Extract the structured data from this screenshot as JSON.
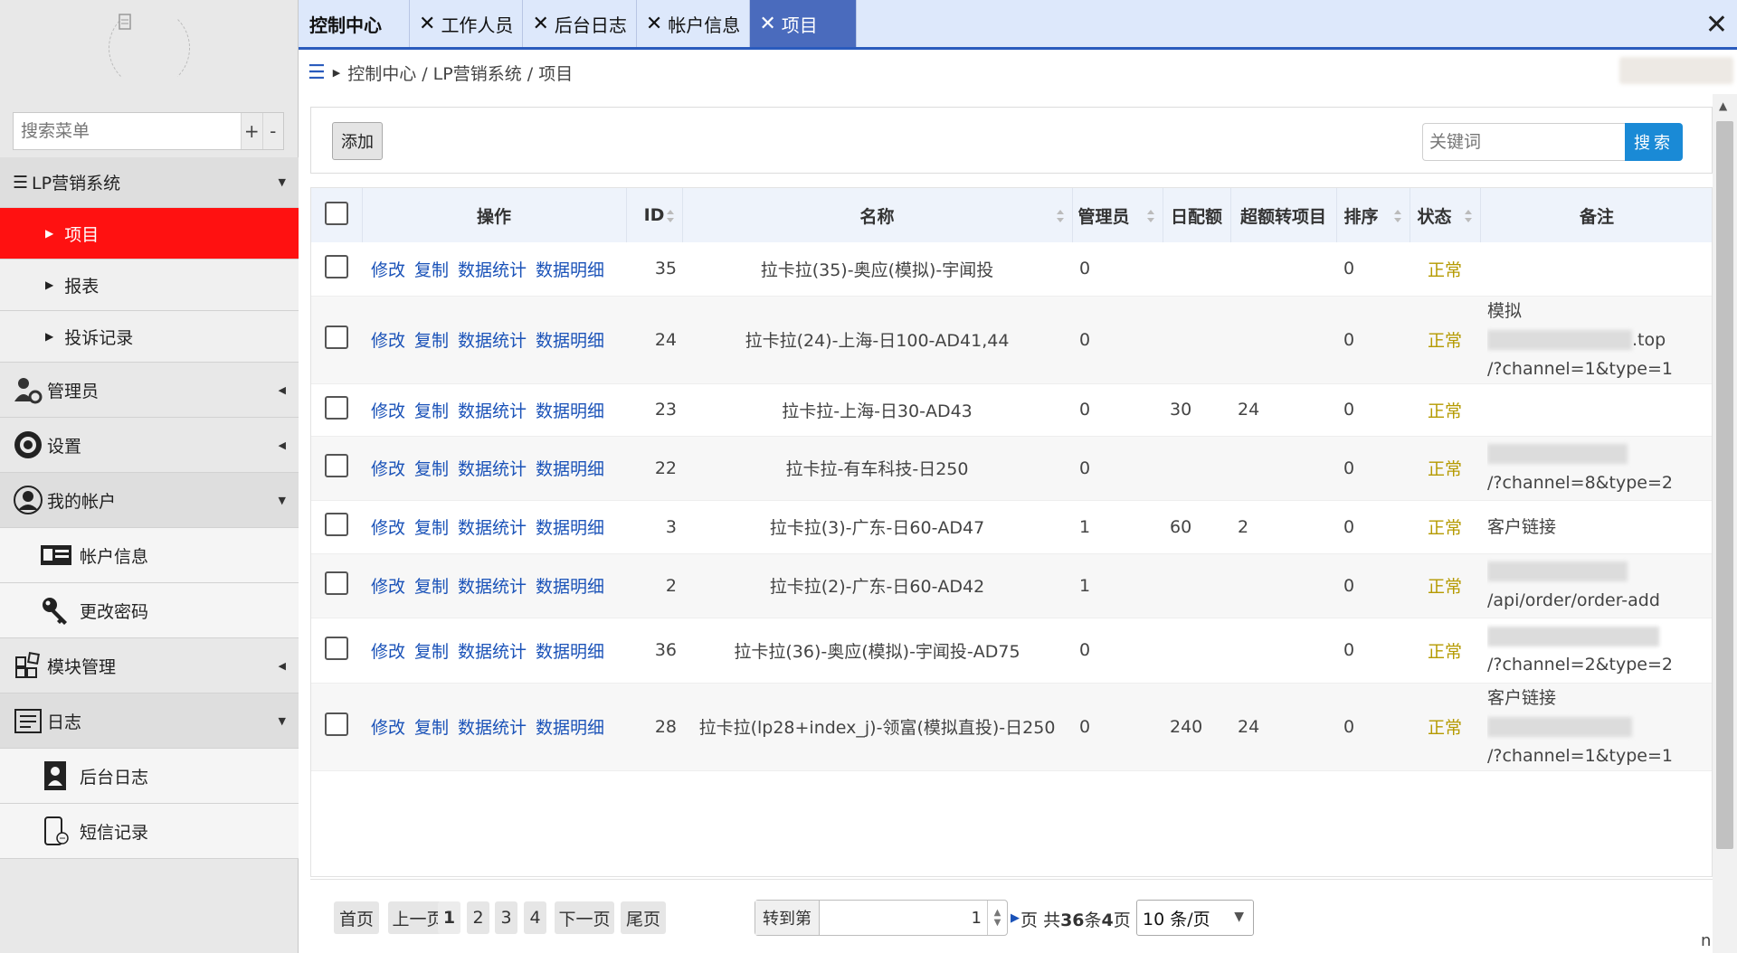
{
  "sidebar": {
    "search_placeholder": "搜索菜单",
    "expand_label": "+",
    "collapse_label": "-",
    "items": {
      "lp": "LP营销系统",
      "project": "项目",
      "report": "报表",
      "complaint": "投诉记录",
      "admin": "管理员",
      "settings": "设置",
      "myaccount": "我的帐户",
      "account_info": "帐户信息",
      "change_pwd": "更改密码",
      "modules": "模块管理",
      "log": "日志",
      "backend_log": "后台日志",
      "sms_log": "短信记录"
    }
  },
  "tabs": {
    "home": "控制中心",
    "staff": "工作人员",
    "backlog": "后台日志",
    "account": "帐户信息",
    "project": "项目",
    "close_all": "✕"
  },
  "breadcrumb": {
    "text": "控制中心 / LP营销系统 / 项目"
  },
  "toolbar": {
    "add_label": "添加",
    "keyword_placeholder": "关键词",
    "search_label": "搜索"
  },
  "table": {
    "headers": {
      "op": "操作",
      "id": "ID",
      "name": "名称",
      "admin": "管理员",
      "daily": "日配额",
      "over": "超额转项目",
      "sort": "排序",
      "status": "状态",
      "note": "备注"
    },
    "ops": {
      "edit": "修改",
      "copy": "复制",
      "stats": "数据统计",
      "detail": "数据明细"
    },
    "rows": [
      {
        "id": "35",
        "name": "拉卡拉(35)-奥应(模拟)-宇闻投",
        "admin": "0",
        "daily": "",
        "over": "",
        "sort": "0",
        "status": "正常",
        "note1": "",
        "note2": "",
        "note3": ""
      },
      {
        "id": "24",
        "name": "拉卡拉(24)-上海-日100-AD41,44",
        "admin": "0",
        "daily": "",
        "over": "",
        "sort": "0",
        "status": "正常",
        "note1": "模拟",
        "note2": ".top",
        "note3": "/?channel=1&type=1"
      },
      {
        "id": "23",
        "name": "拉卡拉-上海-日30-AD43",
        "admin": "0",
        "daily": "30",
        "over": "24",
        "sort": "0",
        "status": "正常",
        "note1": "",
        "note2": "",
        "note3": ""
      },
      {
        "id": "22",
        "name": "拉卡拉-有车科技-日250",
        "admin": "0",
        "daily": "",
        "over": "",
        "sort": "0",
        "status": "正常",
        "note1": "",
        "note2": "/?channel=8&type=2",
        "note3": ""
      },
      {
        "id": "3",
        "name": "拉卡拉(3)-广东-日60-AD47",
        "admin": "1",
        "daily": "60",
        "over": "2",
        "sort": "0",
        "status": "正常",
        "note1": "客户链接",
        "note2": "",
        "note3": ""
      },
      {
        "id": "2",
        "name": "拉卡拉(2)-广东-日60-AD42",
        "admin": "1",
        "daily": "",
        "over": "",
        "sort": "0",
        "status": "正常",
        "note1": "",
        "note2": "/api/order/order-add",
        "note3": ""
      },
      {
        "id": "36",
        "name": "拉卡拉(36)-奥应(模拟)-宇闻投-AD75",
        "admin": "0",
        "daily": "",
        "over": "",
        "sort": "0",
        "status": "正常",
        "note1": "",
        "note2": "/?channel=2&type=2",
        "note3": ""
      },
      {
        "id": "28",
        "name": "拉卡拉(lp28+index_j)-领富(模拟直投)-日250",
        "admin": "0",
        "daily": "240",
        "over": "24",
        "sort": "0",
        "status": "正常",
        "note1": "客户链接",
        "note2": "",
        "note3": "/?channel=1&type=1"
      }
    ]
  },
  "pager": {
    "first": "首页",
    "prev": "上一页",
    "p1": "1",
    "p2": "2",
    "p3": "3",
    "p4": "4",
    "next": "下一页",
    "last": "尾页",
    "goto_label": "转到第",
    "goto_value": "1",
    "page_word": "页",
    "total_prefix": "共",
    "total_count": "36",
    "total_mid": "条",
    "total_pages": "4",
    "total_suffix": "页",
    "page_size": "10 条/页"
  },
  "corner_text": "n",
  "colors": {
    "active_menu": "#ff1111",
    "tab_active": "#4a6bbd",
    "link": "#1a52b8",
    "status_ok": "#b59a00",
    "search_button": "#1a8ad6"
  }
}
